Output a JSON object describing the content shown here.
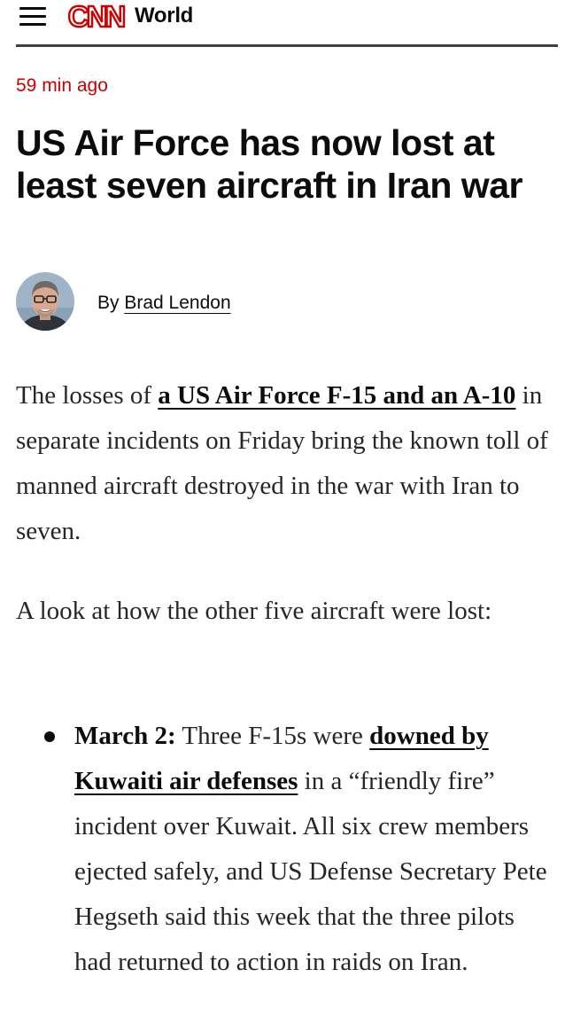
{
  "header": {
    "logo_text": "CNN",
    "section": "World",
    "brand_color": "#cc0000"
  },
  "article": {
    "timestamp": "59 min ago",
    "headline": "US Air Force has now lost at least seven aircraft in Iran war",
    "byline_prefix": "By",
    "author": "Brad Lendon",
    "p1_before": "The losses of ",
    "p1_link": "a US Air Force F-15 and an A-10",
    "p1_after": " in separate incidents on Friday bring the known toll of manned aircraft destroyed in the war with Iran to seven.",
    "p2": "A look at how the other five aircraft were lost:",
    "bullets": [
      {
        "label": "March 2:",
        "text_before": " Three F-15s were ",
        "link": "downed by Kuwaiti air defenses",
        "text_after": " in a “friendly fire” incident over Kuwait. All six crew members ejected safely, and US Defense Secretary Pete Hegseth said this week that the three pilots had returned to action in raids on Iran."
      }
    ]
  },
  "icons": {
    "menu": "hamburger-menu-icon",
    "avatar": "author-photo"
  }
}
